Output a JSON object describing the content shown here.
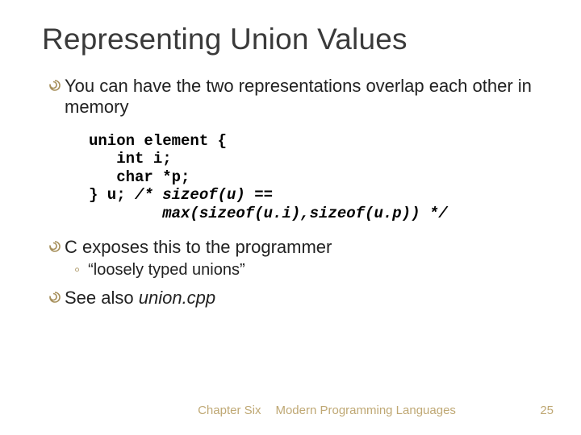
{
  "title": "Representing Union Values",
  "bullets": {
    "b1": "You can have the two representations overlap each other in memory",
    "b2": "C exposes this to the programmer",
    "b2sub": "“loosely typed unions”",
    "b3_prefix": "See also ",
    "b3_italic": "union.cpp"
  },
  "code": {
    "l1": "union element {",
    "l2": "   int i;",
    "l3": "   char *p;",
    "l4_plain": "} u; ",
    "l4_comment": "/* sizeof(u) ==",
    "l5_comment": "        max(sizeof(u.i),sizeof(u.p)) */"
  },
  "footer": {
    "chapter": "Chapter Six",
    "book": "Modern Programming Languages",
    "page": "25"
  },
  "colors": {
    "bullet_accent": "#a68f5a"
  }
}
